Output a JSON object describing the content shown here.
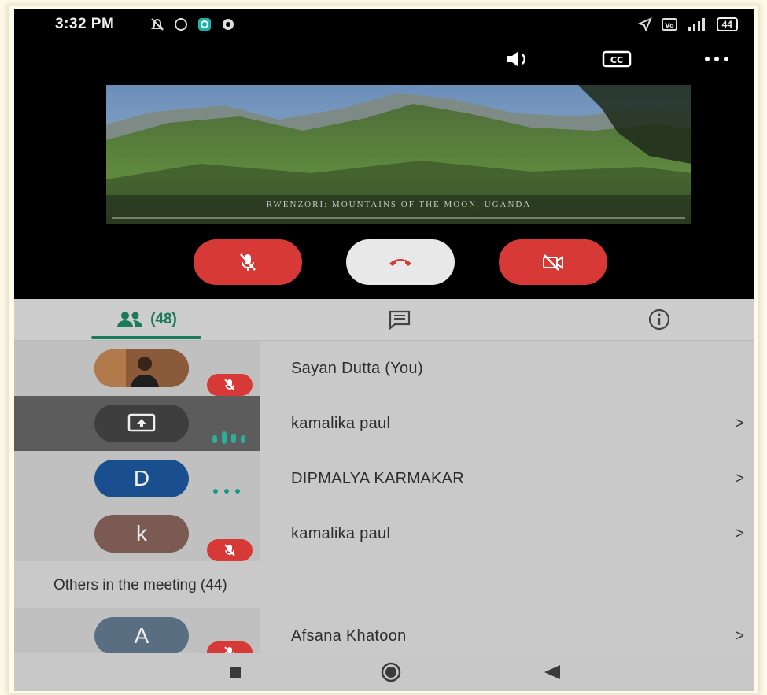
{
  "status_bar": {
    "time": "3:32 PM",
    "battery": "44"
  },
  "top_controls": [
    "speaker-icon",
    "captions-icon",
    "more-options-icon"
  ],
  "video": {
    "caption": "Rwenzori: Mountains of the Moon, Uganda"
  },
  "call_controls": {
    "mic": "mic-off-icon",
    "hangup": "end-call-icon",
    "camera": "camera-off-icon",
    "colors": {
      "mic": "#d73a36",
      "hangup": "#e8e8e8",
      "camera": "#d73a36"
    }
  },
  "tabs": {
    "people_count": "(48)",
    "icons": [
      "people-icon",
      "chat-icon",
      "info-icon"
    ],
    "accent": "#1a7a5a"
  },
  "participants": [
    {
      "name": "Sayan Dutta (You)",
      "avatar": "photo",
      "status": "muted",
      "chevron": ""
    },
    {
      "name": "kamalika paul",
      "avatar": "present-icon",
      "status": "speaking",
      "chevron": ">"
    },
    {
      "name": "DIPMALYA KARMAKAR",
      "avatar": "D",
      "avatar_color": "#1a4f8f",
      "status": "connecting",
      "chevron": ">"
    },
    {
      "name": "kamalika paul",
      "avatar": "k",
      "avatar_color": "#7a5a52",
      "status": "muted",
      "chevron": ">"
    }
  ],
  "others": {
    "header": "Others in the meeting (44)",
    "participants": [
      {
        "name": "Afsana Khatoon",
        "avatar": "A",
        "avatar_color": "#5a6e82",
        "status": "muted",
        "chevron": ">"
      }
    ]
  },
  "nav_bar": [
    "recents-icon",
    "home-icon",
    "back-icon"
  ]
}
